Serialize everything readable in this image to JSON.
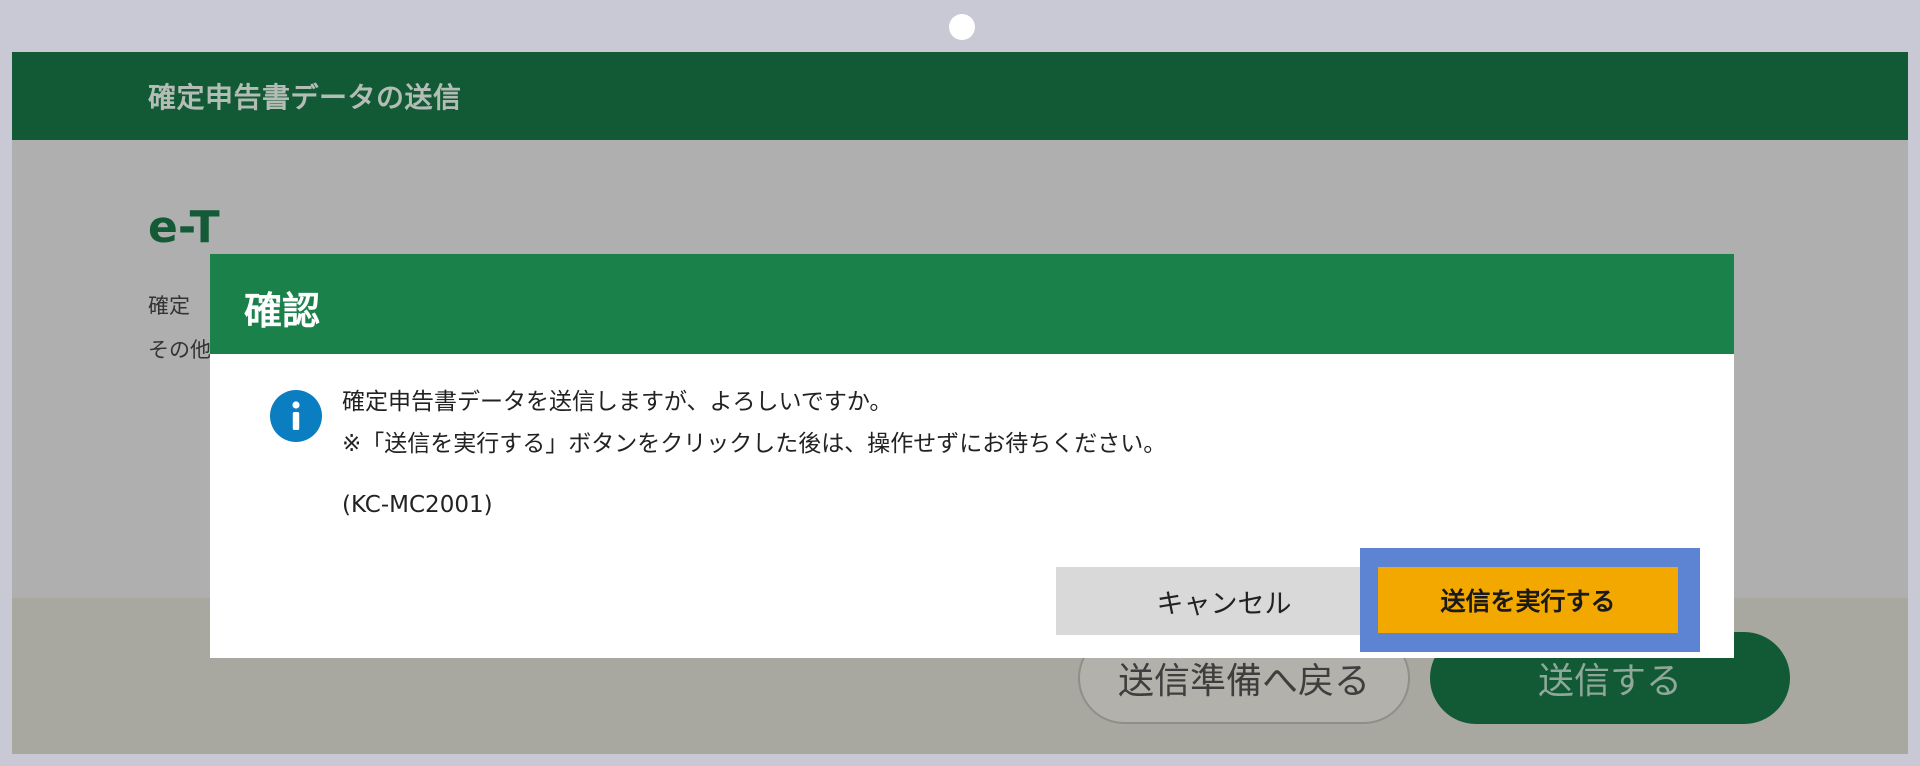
{
  "header": {
    "title": "確定申告書データの送信"
  },
  "page": {
    "heading_partial": "e-T",
    "text_line1_partial": "確定",
    "text_line2_partial": "その他"
  },
  "footer": {
    "back_label": "送信準備へ戻る",
    "send_label": "送信する"
  },
  "dialog": {
    "title": "確認",
    "icon": "info-icon",
    "message_line1": "確定申告書データを送信しますが、よろしいですか。",
    "message_line2": "※「送信を実行する」ボタンをクリックした後は、操作せずにお待ちください。",
    "code": "(KC-MC2001)",
    "cancel_label": "キャンセル",
    "execute_label": "送信を実行する"
  },
  "colors": {
    "header_green": "#125935",
    "dialog_header_green": "#1a814b",
    "execute_orange": "#f3a800",
    "focus_blue": "#5d84d2",
    "info_blue": "#0b7ec1"
  }
}
